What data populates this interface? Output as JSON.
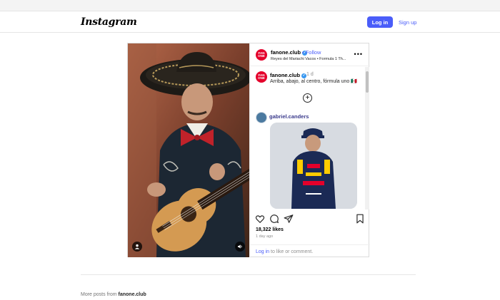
{
  "navbar": {
    "logo": "Instagram",
    "login_label": "Log in",
    "signup_label": "Sign up"
  },
  "post": {
    "header": {
      "avatar_text": "FAN ONE",
      "username": "fanone.club",
      "verified_icon": "verified-badge-icon",
      "follow_label": "• Follow",
      "subtitle": "Reyes del Mariachi Vacos • Formula 1 Th..."
    },
    "caption": {
      "username": "fanone.club",
      "time": "1 d",
      "text": "Arriba, abajo, al centro, fórmula uno 🇲🇽"
    },
    "reply": {
      "username": "gabriel.canders"
    },
    "likes": "18,322 likes",
    "time_ago": "1 day ago",
    "comment_prompt": {
      "login": "Log in",
      "rest": " to like or comment."
    },
    "icons": [
      "heart-icon",
      "comment-icon",
      "share-icon",
      "bookmark-icon",
      "more-options-icon",
      "add-icon",
      "user-tag-icon",
      "sound-icon"
    ]
  },
  "footer": {
    "more_posts_prefix": "More posts from ",
    "more_posts_user": "fanone.club"
  },
  "colors": {
    "accent": "#4a5df9",
    "verified": "#3897f0",
    "fan_avatar": "#e4002b"
  }
}
